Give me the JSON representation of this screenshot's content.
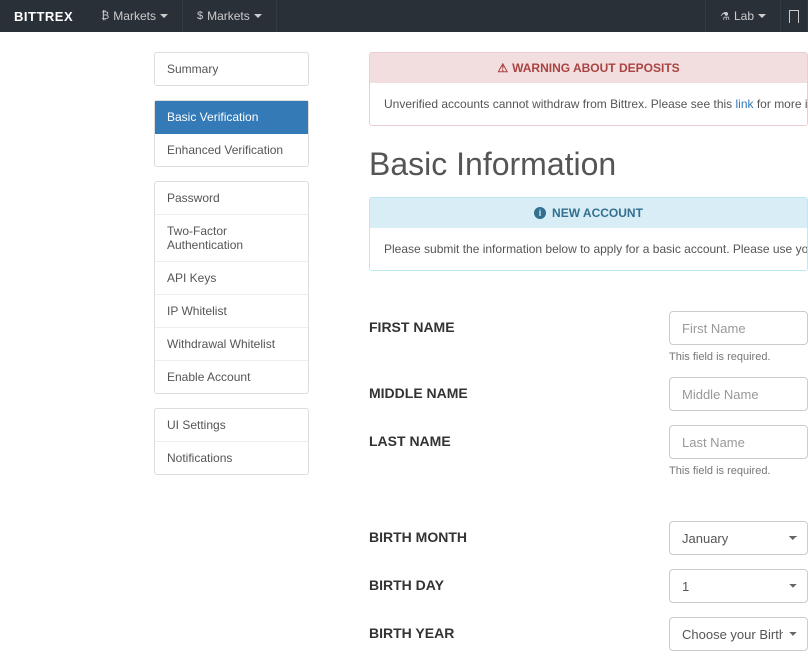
{
  "nav": {
    "brand": "BITTREX",
    "bmarkets": "Markets",
    "dmarkets": "Markets",
    "lab": "Lab"
  },
  "sidebar": {
    "group1": [
      {
        "label": "Summary"
      }
    ],
    "group2": [
      {
        "label": "Basic Verification",
        "active": true
      },
      {
        "label": "Enhanced Verification"
      }
    ],
    "group3": [
      {
        "label": "Password"
      },
      {
        "label": "Two-Factor Authentication"
      },
      {
        "label": "API Keys"
      },
      {
        "label": "IP Whitelist"
      },
      {
        "label": "Withdrawal Whitelist"
      },
      {
        "label": "Enable Account"
      }
    ],
    "group4": [
      {
        "label": "UI Settings"
      },
      {
        "label": "Notifications"
      }
    ]
  },
  "warning": {
    "title": "WARNING ABOUT DEPOSITS",
    "body_pre": "Unverified accounts cannot withdraw from Bittrex. Please see this ",
    "link": "link",
    "body_post": " for more informa"
  },
  "page_title": "Basic Information",
  "info": {
    "title": "NEW ACCOUNT",
    "body": "Please submit the information below to apply for a basic account. Please use your full legal name as it exists on y"
  },
  "form": {
    "first_name": {
      "label": "FIRST NAME",
      "placeholder": "First Name",
      "help": "This field is required."
    },
    "middle_name": {
      "label": "MIDDLE NAME",
      "placeholder": "Middle Name"
    },
    "last_name": {
      "label": "LAST NAME",
      "placeholder": "Last Name",
      "help": "This field is required."
    },
    "birth_month": {
      "label": "BIRTH MONTH",
      "value": "January"
    },
    "birth_day": {
      "label": "BIRTH DAY",
      "value": "1"
    },
    "birth_year": {
      "label": "BIRTH YEAR",
      "value": "Choose your Birth Year ..."
    }
  }
}
